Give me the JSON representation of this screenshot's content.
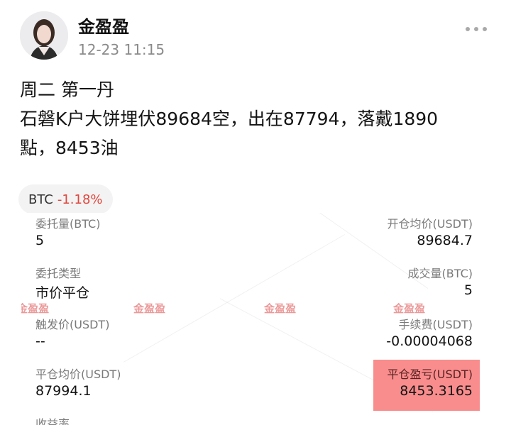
{
  "header": {
    "username": "金盈盈",
    "timestamp": "12-23 11:15"
  },
  "post": {
    "line1": "周二  第一丹",
    "line2": "石磐K户大饼埋伏89684空，出在87794，落戴1890",
    "line3": "點，8453油"
  },
  "ticker": {
    "symbol": "BTC",
    "change": "-1.18%"
  },
  "order": {
    "qty_label": "委托量(BTC)",
    "qty_value": "5",
    "open_avg_label": "开仓均价(USDT)",
    "open_avg_value": "89684.7",
    "type_label": "委托类型",
    "type_value": "市价平仓",
    "filled_label": "成交量(BTC)",
    "filled_value": "5",
    "trigger_label": "触发价(USDT)",
    "trigger_value": "--",
    "fee_label": "手续费(USDT)",
    "fee_value": "-0.00004068",
    "close_avg_label": "平仓均价(USDT)",
    "close_avg_value": "87994.1",
    "pnl_label": "平仓盈亏(USDT)",
    "pnl_value": "8453.3165",
    "next_label": "收益率"
  },
  "watermark": {
    "text": "金盈盈"
  },
  "colors": {
    "negative": "#e0463c",
    "highlight": "#f98d8d"
  }
}
